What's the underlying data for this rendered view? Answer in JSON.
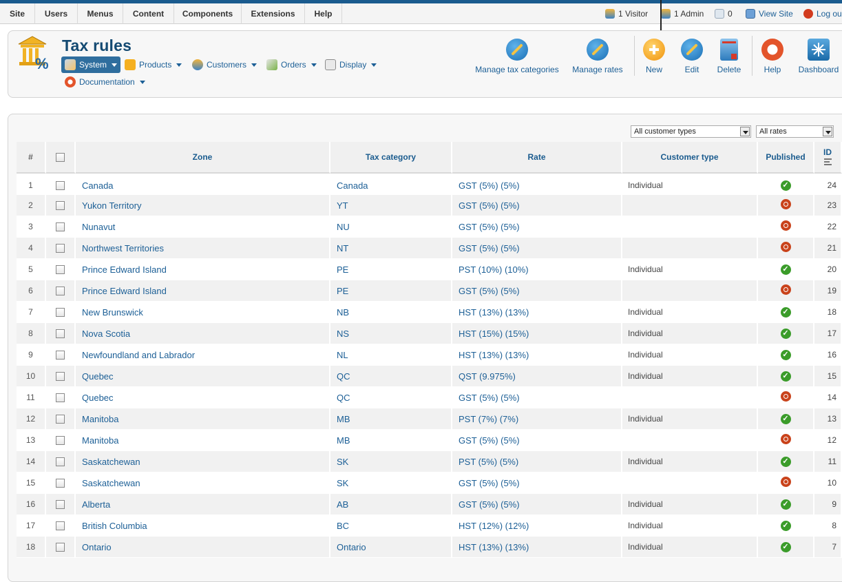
{
  "menu": {
    "items": [
      "Site",
      "Users",
      "Menus",
      "Content",
      "Components",
      "Extensions",
      "Help"
    ]
  },
  "status": {
    "visitors": "1 Visitor",
    "admins": "1 Admin",
    "messages": "0",
    "view_site": "View Site",
    "logout": "Log ou"
  },
  "header": {
    "title": "Tax rules",
    "submenu": {
      "system": "System",
      "products": "Products",
      "customers": "Customers",
      "orders": "Orders",
      "display": "Display",
      "documentation": "Documentation"
    }
  },
  "toolbar": {
    "manage_tax_categories": "Manage tax categories",
    "manage_rates": "Manage rates",
    "new": "New",
    "edit": "Edit",
    "delete": "Delete",
    "help": "Help",
    "dashboard": "Dashboard"
  },
  "filters": {
    "customer_types": "All customer types",
    "rates": "All rates"
  },
  "table": {
    "headers": {
      "num": "#",
      "zone": "Zone",
      "tax_category": "Tax category",
      "rate": "Rate",
      "customer_type": "Customer type",
      "published": "Published",
      "id": "ID"
    },
    "rows": [
      {
        "num": "1",
        "zone": "Canada",
        "tax_category": "Canada",
        "rate": "GST (5%) (5%)",
        "customer_type": "Individual",
        "published": true,
        "id": "24"
      },
      {
        "num": "2",
        "zone": "Yukon Territory",
        "tax_category": "YT",
        "rate": "GST (5%) (5%)",
        "customer_type": "",
        "published": false,
        "id": "23"
      },
      {
        "num": "3",
        "zone": "Nunavut",
        "tax_category": "NU",
        "rate": "GST (5%) (5%)",
        "customer_type": "",
        "published": false,
        "id": "22"
      },
      {
        "num": "4",
        "zone": "Northwest Territories",
        "tax_category": "NT",
        "rate": "GST (5%) (5%)",
        "customer_type": "",
        "published": false,
        "id": "21"
      },
      {
        "num": "5",
        "zone": "Prince Edward Island",
        "tax_category": "PE",
        "rate": "PST (10%) (10%)",
        "customer_type": "Individual",
        "published": true,
        "id": "20"
      },
      {
        "num": "6",
        "zone": "Prince Edward Island",
        "tax_category": "PE",
        "rate": "GST (5%) (5%)",
        "customer_type": "",
        "published": false,
        "id": "19"
      },
      {
        "num": "7",
        "zone": "New Brunswick",
        "tax_category": "NB",
        "rate": "HST (13%) (13%)",
        "customer_type": "Individual",
        "published": true,
        "id": "18"
      },
      {
        "num": "8",
        "zone": "Nova Scotia",
        "tax_category": "NS",
        "rate": "HST (15%) (15%)",
        "customer_type": "Individual",
        "published": true,
        "id": "17"
      },
      {
        "num": "9",
        "zone": "Newfoundland and Labrador",
        "tax_category": "NL",
        "rate": "HST (13%) (13%)",
        "customer_type": "Individual",
        "published": true,
        "id": "16"
      },
      {
        "num": "10",
        "zone": "Quebec",
        "tax_category": "QC",
        "rate": "QST (9.975%)",
        "customer_type": "Individual",
        "published": true,
        "id": "15"
      },
      {
        "num": "11",
        "zone": "Quebec",
        "tax_category": "QC",
        "rate": "GST (5%) (5%)",
        "customer_type": "",
        "published": false,
        "id": "14"
      },
      {
        "num": "12",
        "zone": "Manitoba",
        "tax_category": "MB",
        "rate": "PST (7%) (7%)",
        "customer_type": "Individual",
        "published": true,
        "id": "13"
      },
      {
        "num": "13",
        "zone": "Manitoba",
        "tax_category": "MB",
        "rate": "GST (5%) (5%)",
        "customer_type": "",
        "published": false,
        "id": "12"
      },
      {
        "num": "14",
        "zone": "Saskatchewan",
        "tax_category": "SK",
        "rate": "PST (5%) (5%)",
        "customer_type": "Individual",
        "published": true,
        "id": "11"
      },
      {
        "num": "15",
        "zone": "Saskatchewan",
        "tax_category": "SK",
        "rate": "GST (5%) (5%)",
        "customer_type": "",
        "published": false,
        "id": "10"
      },
      {
        "num": "16",
        "zone": "Alberta",
        "tax_category": "AB",
        "rate": "GST (5%) (5%)",
        "customer_type": "Individual",
        "published": true,
        "id": "9"
      },
      {
        "num": "17",
        "zone": "British Columbia",
        "tax_category": "BC",
        "rate": "HST (12%) (12%)",
        "customer_type": "Individual",
        "published": true,
        "id": "8"
      },
      {
        "num": "18",
        "zone": "Ontario",
        "tax_category": "Ontario",
        "rate": "HST (13%) (13%)",
        "customer_type": "Individual",
        "published": true,
        "id": "7"
      }
    ]
  },
  "icons": {
    "published_yes": "check-circle-icon",
    "published_no": "unpublished-circle-icon"
  },
  "colors": {
    "brand_blue": "#1a5b8e",
    "link_blue": "#1c5f96",
    "published_green": "#3b9c2a",
    "unpublished_red": "#c9431b",
    "new_orange": "#f4a11a"
  }
}
